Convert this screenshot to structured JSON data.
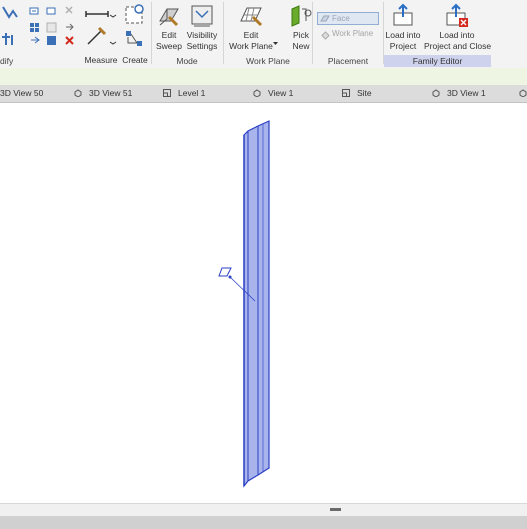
{
  "ribbon": {
    "modify_partial": "dify",
    "measure": "Measure",
    "create": "Create",
    "edit_sweep": [
      "Edit",
      "Sweep"
    ],
    "visibility_settings": [
      "Visibility",
      "Settings"
    ],
    "edit_work_plane": [
      "Edit",
      "Work Plane"
    ],
    "pick_new": [
      "Pick",
      "New"
    ],
    "face": "Face",
    "work_plane": "Work Plane",
    "load_into_project": [
      "Load into",
      "Project"
    ],
    "load_into_project_close": [
      "Load into",
      "Project and Close"
    ],
    "panels": {
      "mode": "Mode",
      "work_plane": "Work Plane",
      "placement": "Placement",
      "family_editor": "Family Editor"
    }
  },
  "tabs": [
    "3D View 50",
    "3D View 51",
    "Level 1",
    "View 1",
    "Site",
    "3D View 1"
  ],
  "colors": {
    "sweep_fill": "#a9b4ec",
    "sweep_stroke": "#2b3fc4",
    "family_editor_panel": "#cfd2ec",
    "options_strip": "#eef6e3"
  }
}
